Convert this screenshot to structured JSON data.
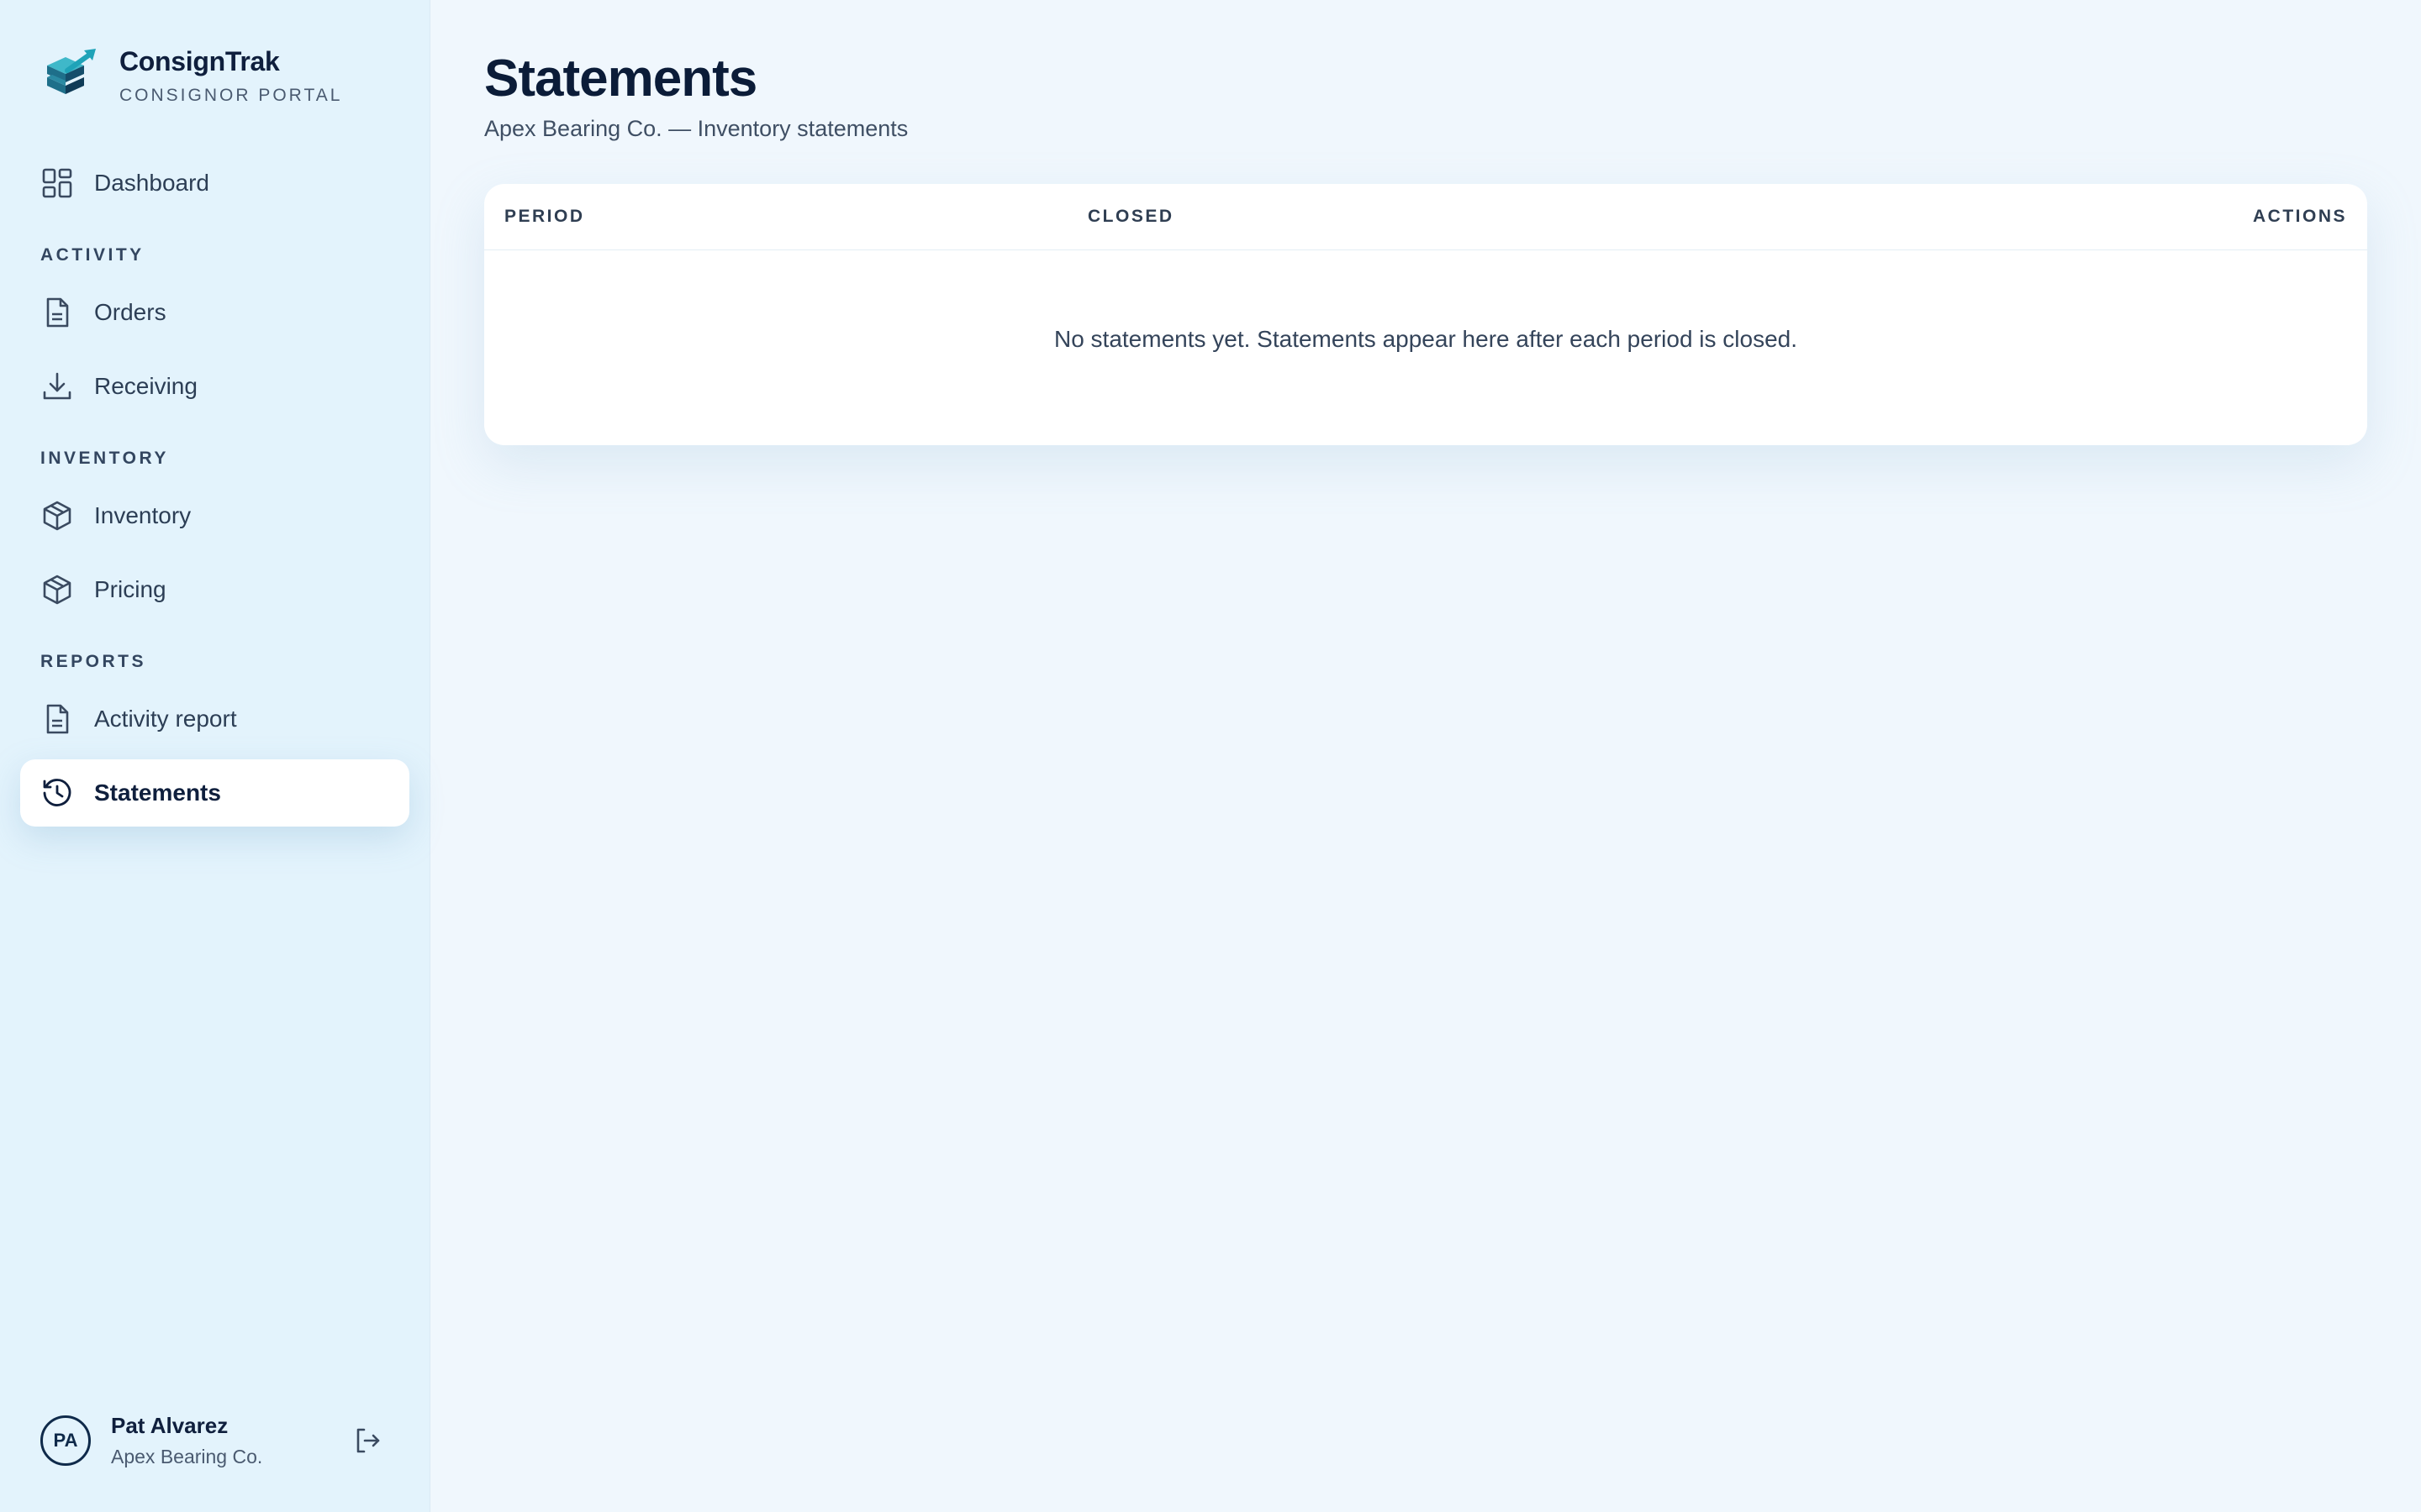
{
  "brand": {
    "name": "ConsignTrak",
    "subtitle": "CONSIGNOR PORTAL"
  },
  "nav": {
    "dashboard": "Dashboard",
    "sections": {
      "activity": "ACTIVITY",
      "inventory": "INVENTORY",
      "reports": "REPORTS"
    },
    "orders": "Orders",
    "receiving": "Receiving",
    "inventory": "Inventory",
    "pricing": "Pricing",
    "activity_report": "Activity report",
    "statements": "Statements",
    "active_item": "Statements"
  },
  "user": {
    "initials": "PA",
    "name": "Pat Alvarez",
    "org": "Apex Bearing Co."
  },
  "page": {
    "title": "Statements",
    "subtitle": "Apex Bearing Co. — Inventory statements"
  },
  "table": {
    "columns": [
      "PERIOD",
      "CLOSED",
      "ACTIONS"
    ],
    "rows": [],
    "empty_message": "No statements yet. Statements appear here after each period is closed."
  },
  "colors": {
    "sidebar_bg": "#e3f3fc",
    "main_bg": "#f0f7fd",
    "text_primary": "#0f1f3d",
    "accent": "#1fa3b8"
  },
  "icons": {
    "dashboard": "grid-icon",
    "orders": "document-icon",
    "receiving": "download-icon",
    "inventory": "box-icon",
    "pricing": "box-icon",
    "activity_report": "document-icon",
    "statements": "history-icon",
    "logout": "logout-icon"
  }
}
